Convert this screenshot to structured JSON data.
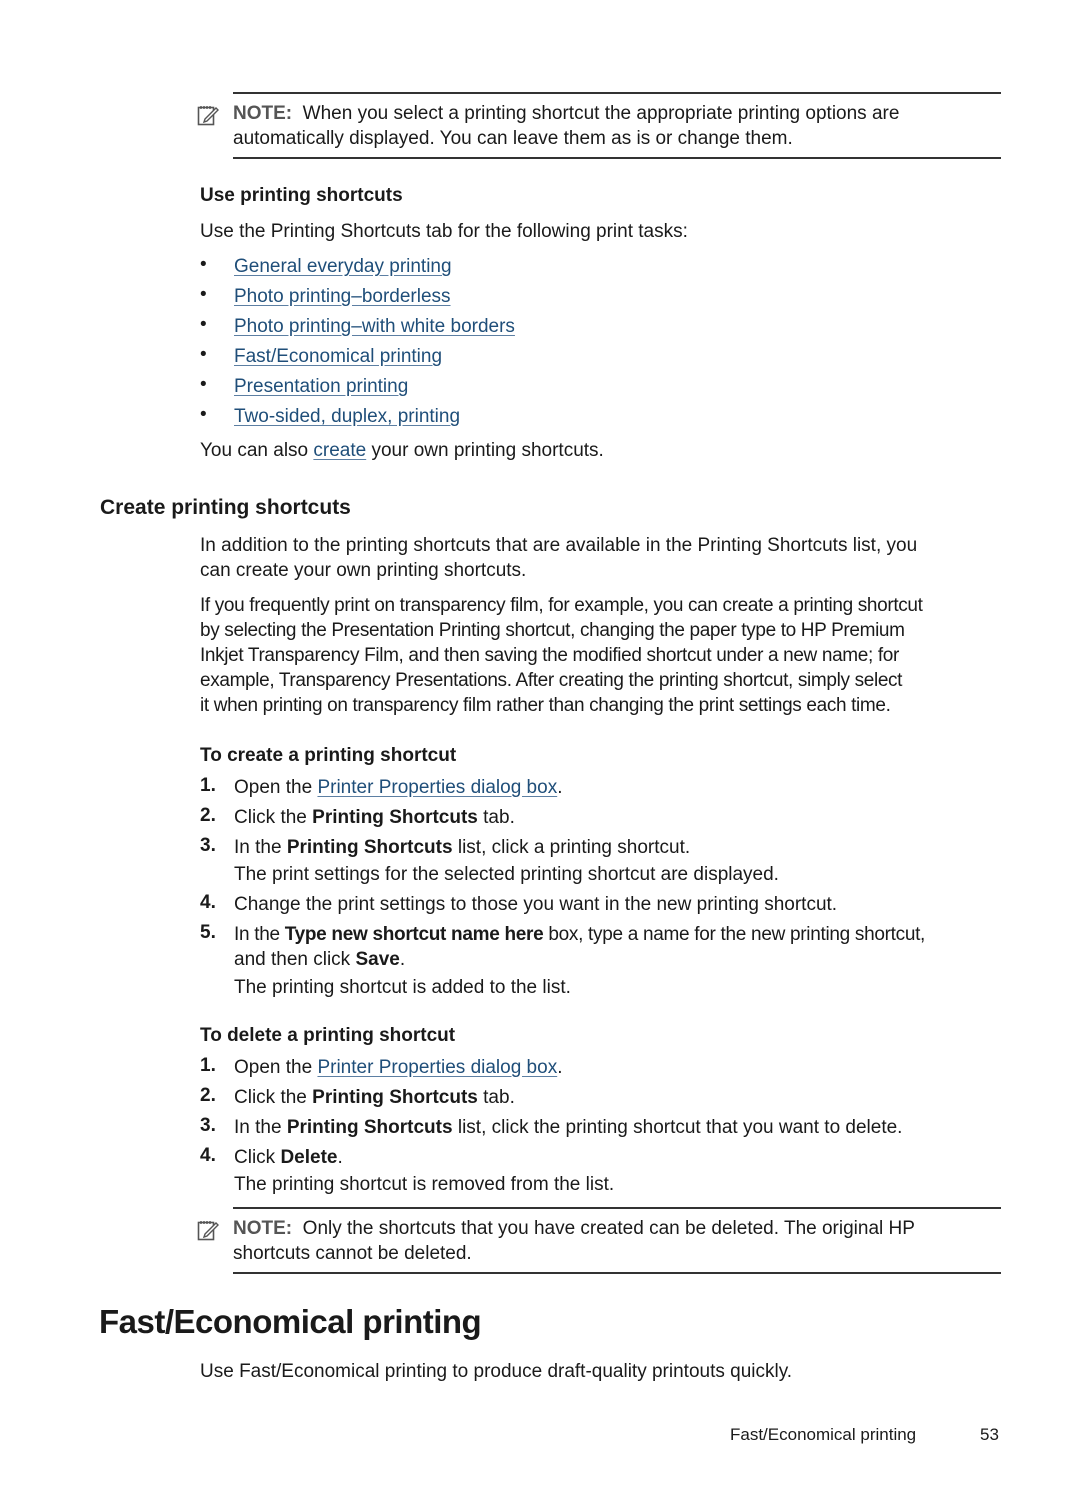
{
  "note1": {
    "label": "NOTE:",
    "text_line1": "When you select a printing shortcut the appropriate printing options are",
    "text_line2": "automatically displayed. You can leave them as is or change them."
  },
  "use_shortcuts": {
    "heading": "Use printing shortcuts",
    "intro": "Use the Printing Shortcuts tab for the following print tasks:",
    "links": [
      "General everyday printing",
      "Photo printing–borderless",
      "Photo printing–with white borders",
      "Fast/Economical printing",
      "Presentation printing",
      "Two-sided, duplex, printing"
    ],
    "also_pre": "You can also ",
    "also_link": "create",
    "also_post": " your own printing shortcuts."
  },
  "create_section": {
    "heading": "Create printing shortcuts",
    "para1_line1": "In addition to the printing shortcuts that are available in the Printing Shortcuts list, you",
    "para1_line2": "can create your own printing shortcuts.",
    "para2_lines": [
      "If you frequently print on transparency film, for example, you can create a printing shortcut",
      "by selecting the Presentation Printing shortcut, changing the paper type to HP Premium",
      "Inkjet Transparency Film, and then saving the modified shortcut under a new name; for",
      "example, Transparency Presentations. After creating the printing shortcut, simply select",
      "it when printing on transparency film rather than changing the print settings each time."
    ]
  },
  "to_create": {
    "heading": "To create a printing shortcut",
    "steps": [
      {
        "num": "1.",
        "pre": "Open the ",
        "link": "Printer Properties dialog box",
        "post": "."
      },
      {
        "num": "2.",
        "pre": "Click the ",
        "bold": "Printing Shortcuts",
        "post": " tab."
      },
      {
        "num": "3.",
        "pre": "In the ",
        "bold": "Printing Shortcuts",
        "post": " list, click a printing shortcut.",
        "result": "The print settings for the selected printing shortcut are displayed."
      },
      {
        "num": "4.",
        "text": "Change the print settings to those you want in the new printing shortcut."
      },
      {
        "num": "5.",
        "pre": "In the ",
        "bold": "Type new shortcut name here",
        "post": " box, type a name for the new printing shortcut,",
        "line2_pre": "and then click ",
        "line2_bold": "Save",
        "line2_post": ".",
        "result": "The printing shortcut is added to the list."
      }
    ]
  },
  "to_delete": {
    "heading": "To delete a printing shortcut",
    "steps": [
      {
        "num": "1.",
        "pre": "Open the ",
        "link": "Printer Properties dialog box",
        "post": "."
      },
      {
        "num": "2.",
        "pre": "Click the ",
        "bold": "Printing Shortcuts",
        "post": " tab."
      },
      {
        "num": "3.",
        "pre": "In the ",
        "bold": "Printing Shortcuts",
        "post": " list, click the printing shortcut that you want to delete."
      },
      {
        "num": "4.",
        "pre": "Click ",
        "bold": "Delete",
        "post": ".",
        "result": "The printing shortcut is removed from the list."
      }
    ]
  },
  "note2": {
    "label": "NOTE:",
    "text_line1": "Only the shortcuts that you have created can be deleted. The original HP",
    "text_line2": "shortcuts cannot be deleted."
  },
  "fast_section": {
    "heading": "Fast/Economical printing",
    "text": "Use Fast/Economical printing to produce draft-quality printouts quickly."
  },
  "footer": {
    "section": "Fast/Economical printing",
    "page": "53"
  },
  "colors": {
    "link": "#1f4e79",
    "text": "#1a1a1a"
  }
}
